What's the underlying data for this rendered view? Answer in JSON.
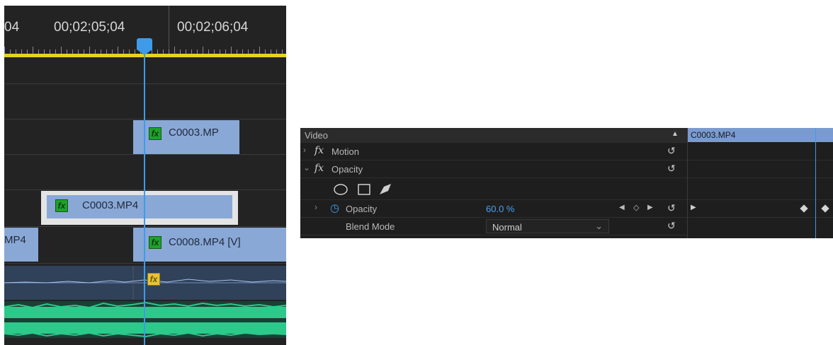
{
  "timeline": {
    "timecodes": [
      "04",
      "00;02;05;04",
      "00;02;06;04"
    ],
    "clips": [
      {
        "label": "C0003.MP"
      },
      {
        "label": "C0003.MP4"
      },
      {
        "label": "MP4"
      },
      {
        "label": "C0008.MP4 [V]"
      }
    ],
    "fx_badge": "fx",
    "colors": {
      "playhead": "#3d9be9",
      "ruler": "#e8d21f",
      "clip": "#8aa8d6",
      "audio_wave": "#2bc98a"
    }
  },
  "effect_controls": {
    "section_title": "Video",
    "clip_name": "C0003.MP4",
    "fx_symbol": "fx",
    "motion_label": "Motion",
    "opacity_label": "Opacity",
    "opacity_param_label": "Opacity",
    "opacity_value": "60.0 %",
    "blend_mode_label": "Blend Mode",
    "blend_mode_value": "Normal",
    "icons": {
      "reset": "reset-icon",
      "ellipse": "ellipse-mask-icon",
      "rect": "rectangle-mask-icon",
      "pen": "pen-mask-icon",
      "stopwatch": "stopwatch-icon"
    }
  }
}
